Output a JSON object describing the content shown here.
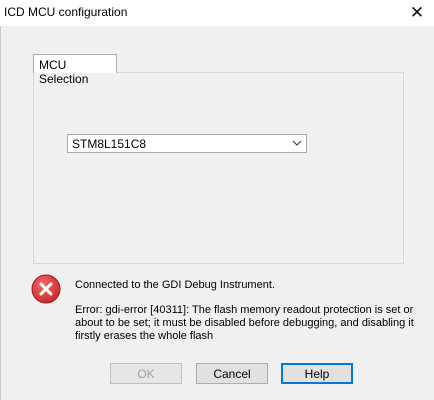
{
  "window": {
    "title": "ICD MCU configuration",
    "close_icon": "close-icon"
  },
  "tabs": [
    {
      "label": "MCU Selection",
      "active": true
    }
  ],
  "mcu_select": {
    "value": "STM8L151C8",
    "icon": "chevron-down-icon"
  },
  "message": {
    "icon": "error-icon",
    "icon_color": "#d32f2f",
    "status": "Connected to the GDI Debug Instrument.",
    "error": "Error: gdi-error [40311]: The flash memory readout protection is set or about to be set; it must be disabled before debugging, and disabling it firstly erases the whole flash"
  },
  "buttons": {
    "ok": {
      "label": "OK",
      "enabled": false
    },
    "cancel": {
      "label": "Cancel",
      "enabled": true
    },
    "help": {
      "label": "Help",
      "enabled": true,
      "default": true
    }
  },
  "colors": {
    "accent": "#0078d7",
    "background": "#f0f0f0"
  }
}
